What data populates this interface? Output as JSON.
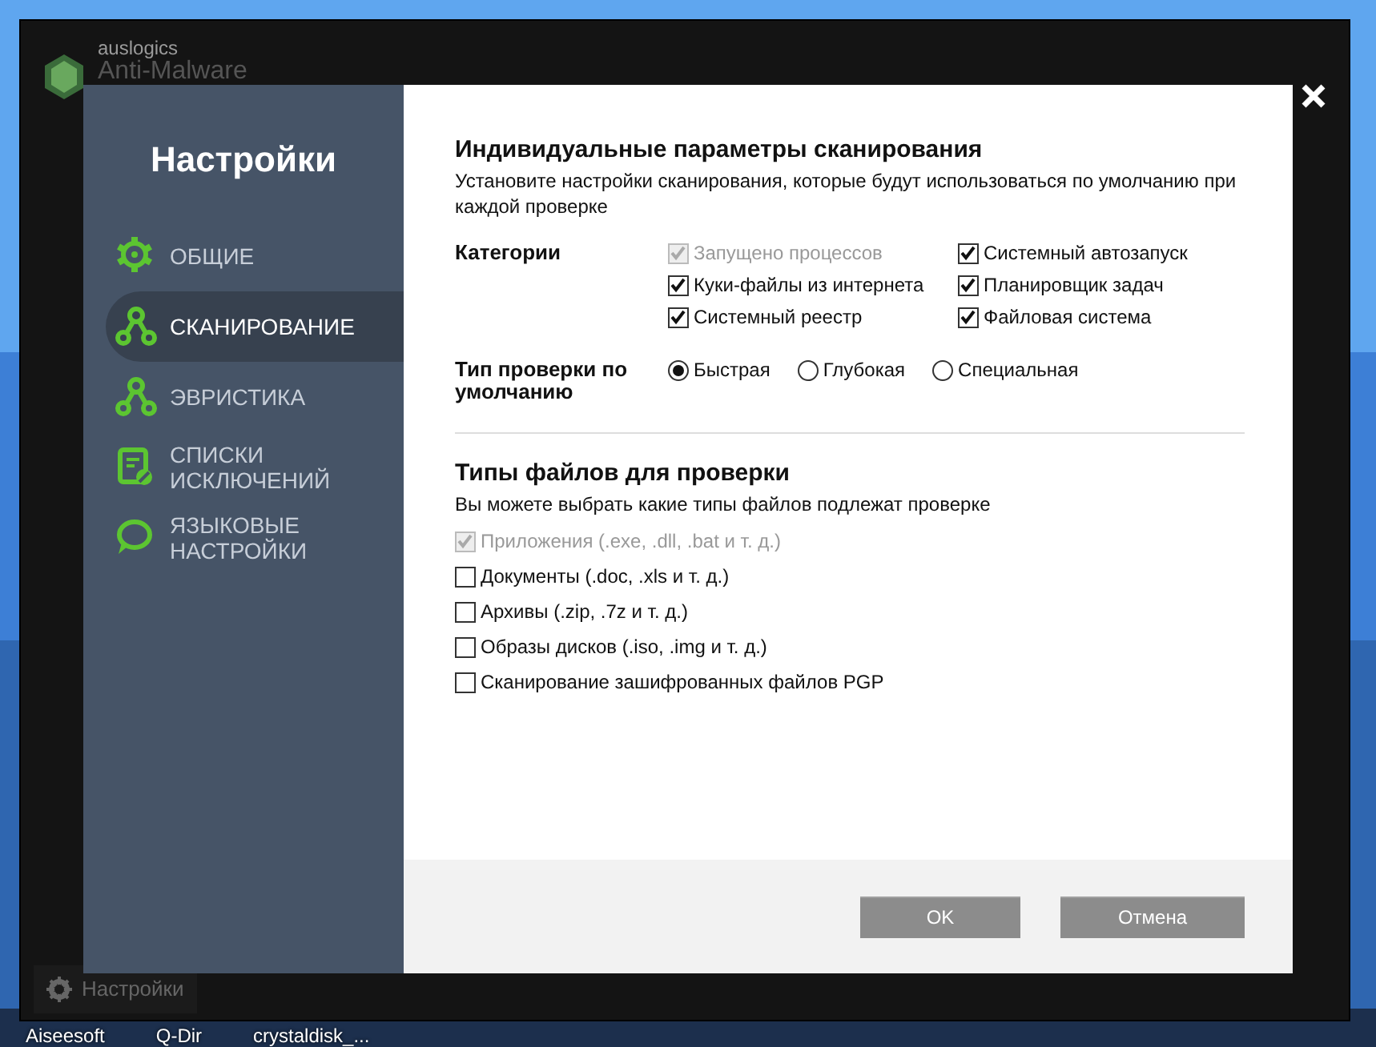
{
  "background_app": {
    "brand": "auslogics",
    "product": "Anti-Malware",
    "footer_button": "Настройки"
  },
  "desktop_icons": [
    "Aiseesoft",
    "Q-Dir",
    "crystaldisk_..."
  ],
  "dialog": {
    "title": "Настройки",
    "nav": [
      {
        "label": "ОБЩИЕ",
        "kind": "gear",
        "selected": false
      },
      {
        "label": "СКАНИРОВАНИЕ",
        "kind": "nodes",
        "selected": true
      },
      {
        "label": "ЭВРИСТИКА",
        "kind": "nodes",
        "selected": false
      },
      {
        "label": "СПИСКИ ИСКЛЮЧЕНИЙ",
        "kind": "list",
        "selected": false
      },
      {
        "label": "ЯЗЫКОВЫЕ НАСТРОЙКИ",
        "kind": "chat",
        "selected": false
      }
    ],
    "scan_section": {
      "heading": "Индивидуальные параметры сканирования",
      "description": "Установите настройки сканирования, которые будут использоваться по умолчанию при каждой проверке",
      "categories_label": "Категории",
      "categories": [
        {
          "label": "Запущено процессов",
          "checked": true,
          "disabled": true
        },
        {
          "label": "Системный автозапуск",
          "checked": true,
          "disabled": false
        },
        {
          "label": "Куки-файлы из интернета",
          "checked": true,
          "disabled": false
        },
        {
          "label": "Планировщик задач",
          "checked": true,
          "disabled": false
        },
        {
          "label": "Системный реестр",
          "checked": true,
          "disabled": false
        },
        {
          "label": "Файловая система",
          "checked": true,
          "disabled": false
        }
      ],
      "scan_type_label": "Тип проверки по умолчанию",
      "scan_types": [
        {
          "label": "Быстрая",
          "selected": true
        },
        {
          "label": "Глубокая",
          "selected": false
        },
        {
          "label": "Специальная",
          "selected": false
        }
      ]
    },
    "file_section": {
      "heading": "Типы файлов для проверки",
      "description": "Вы можете выбрать какие типы файлов подлежат проверке",
      "file_types": [
        {
          "label": "Приложения (.exe, .dll, .bat и т. д.)",
          "checked": true,
          "disabled": true
        },
        {
          "label": "Документы (.doc, .xls и т. д.)",
          "checked": false,
          "disabled": false
        },
        {
          "label": "Архивы (.zip, .7z и т. д.)",
          "checked": false,
          "disabled": false
        },
        {
          "label": "Образы дисков (.iso, .img и т. д.)",
          "checked": false,
          "disabled": false
        },
        {
          "label": "Сканирование зашифрованных файлов PGP",
          "checked": false,
          "disabled": false
        }
      ]
    },
    "buttons": [
      "OK",
      "Отмена"
    ]
  }
}
